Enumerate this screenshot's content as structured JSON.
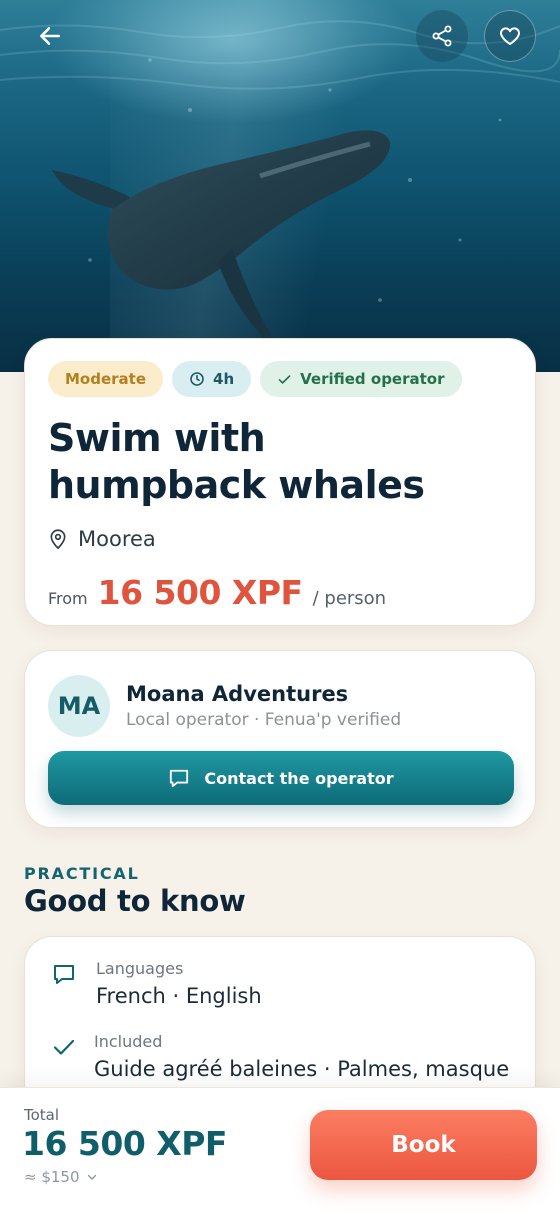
{
  "hero": {
    "image_alt": "Humpback whale swimming underwater",
    "back_icon": "arrow-left-icon",
    "share_icon": "share-icon",
    "favorite_icon": "heart-icon"
  },
  "summary": {
    "tags": {
      "level": "Moderate",
      "duration": "4h",
      "verified": "Verified operator"
    },
    "title": "Swim with humpback whales",
    "location": "Moorea",
    "price_prefix": "From",
    "price": "16 500 XPF",
    "price_unit": "/ person"
  },
  "operator": {
    "initials": "MA",
    "name": "Moana Adventures",
    "subtitle": "Local operator · Fenua'p verified",
    "contact_label": "Contact the operator"
  },
  "practical": {
    "eyebrow": "PRACTICAL",
    "title": "Good to know",
    "items": [
      {
        "icon": "chat-bubble-icon",
        "label": "Languages",
        "value": "French · English"
      },
      {
        "icon": "check-icon",
        "label": "Included",
        "value": "Guide agréé baleines · Palmes, masque"
      }
    ]
  },
  "booking": {
    "total_label": "Total",
    "total": "16 500 XPF",
    "approx": "≈ $150",
    "book_label": "Book"
  },
  "colors": {
    "accent_teal": "#0d6b78",
    "price_red": "#e0533d",
    "book_orange": "#ec5640",
    "background": "#f6f1e9"
  }
}
